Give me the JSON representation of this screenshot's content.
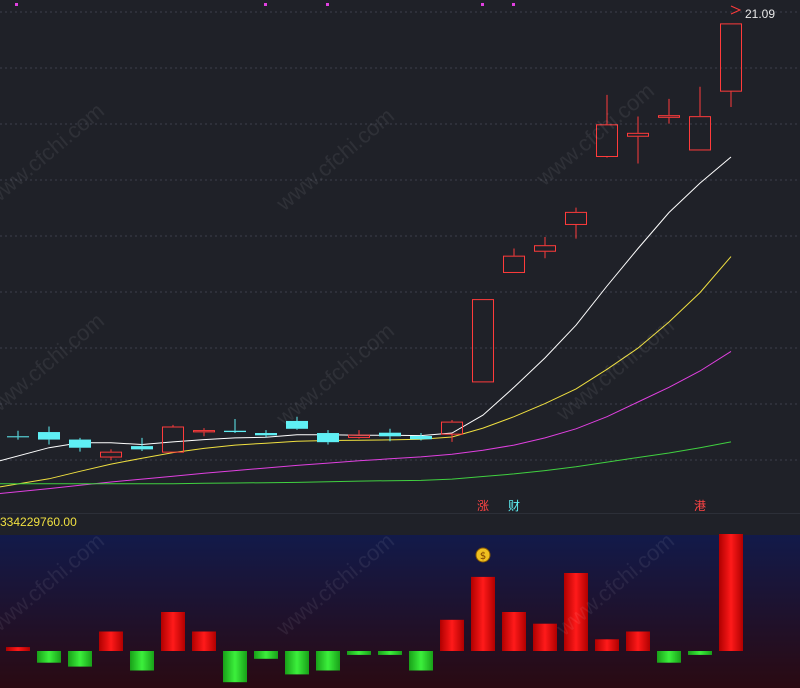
{
  "chart_data": [
    {
      "type": "candlestick",
      "title": "",
      "price_label": "21.09",
      "markers": [
        {
          "label": "涨",
          "candle_index": 15
        },
        {
          "label": "财",
          "candle_index": 16
        },
        {
          "label": "港",
          "candle_index": 22
        }
      ],
      "candles": [
        {
          "open": 8.45,
          "close": 8.42,
          "high": 8.62,
          "low": 8.35
        },
        {
          "open": 8.58,
          "close": 8.35,
          "high": 8.75,
          "low": 8.2
        },
        {
          "open": 8.35,
          "close": 8.1,
          "high": 8.4,
          "low": 7.98
        },
        {
          "open": 7.8,
          "close": 7.98,
          "high": 8.05,
          "low": 7.72
        },
        {
          "open": 8.15,
          "close": 8.05,
          "high": 8.4,
          "low": 8.0
        },
        {
          "open": 7.95,
          "close": 8.75,
          "high": 8.8,
          "low": 7.95
        },
        {
          "open": 8.57,
          "close": 8.64,
          "high": 8.7,
          "low": 8.45
        },
        {
          "open": 8.62,
          "close": 8.58,
          "high": 8.98,
          "low": 8.55
        },
        {
          "open": 8.55,
          "close": 8.48,
          "high": 8.64,
          "low": 8.42
        },
        {
          "open": 8.92,
          "close": 8.68,
          "high": 9.05,
          "low": 8.65
        },
        {
          "open": 8.55,
          "close": 8.27,
          "high": 8.64,
          "low": 8.2
        },
        {
          "open": 8.4,
          "close": 8.5,
          "high": 8.64,
          "low": 8.38
        },
        {
          "open": 8.56,
          "close": 8.45,
          "high": 8.68,
          "low": 8.3
        },
        {
          "open": 8.46,
          "close": 8.36,
          "high": 8.55,
          "low": 8.32
        },
        {
          "open": 8.5,
          "close": 8.9,
          "high": 8.95,
          "low": 8.28
        },
        {
          "open": 10.1,
          "close": 12.65,
          "high": 12.65,
          "low": 10.1
        },
        {
          "open": 13.45,
          "close": 13.98,
          "high": 14.2,
          "low": 13.45
        },
        {
          "open": 14.1,
          "close": 14.3,
          "high": 14.55,
          "low": 13.9
        },
        {
          "open": 14.92,
          "close": 15.32,
          "high": 15.45,
          "low": 14.5
        },
        {
          "open": 17.0,
          "close": 18.0,
          "high": 18.9,
          "low": 16.98
        },
        {
          "open": 17.62,
          "close": 17.74,
          "high": 18.24,
          "low": 16.8
        },
        {
          "open": 18.2,
          "close": 18.28,
          "high": 18.78,
          "low": 18.02
        },
        {
          "open": 17.2,
          "close": 18.25,
          "high": 19.15,
          "low": 17.2
        },
        {
          "open": 19.0,
          "close": 21.09,
          "high": 21.09,
          "low": 18.53
        }
      ],
      "moving_averages": [
        {
          "color": "#ffffff",
          "values": [
            7.7,
            8.1,
            8.25,
            8.25,
            8.2,
            8.28,
            8.35,
            8.4,
            8.42,
            8.5,
            8.5,
            8.48,
            8.48,
            8.47,
            8.55,
            9.1,
            9.95,
            10.85,
            11.85,
            13.05,
            14.2,
            15.3,
            16.2,
            17.0
          ]
        },
        {
          "color": "#f0e040",
          "values": [
            6.9,
            7.15,
            7.38,
            7.6,
            7.78,
            7.95,
            8.08,
            8.18,
            8.24,
            8.3,
            8.32,
            8.33,
            8.34,
            8.36,
            8.43,
            8.7,
            9.05,
            9.45,
            9.9,
            10.5,
            11.15,
            11.95,
            12.85,
            13.95
          ]
        },
        {
          "color": "#e040e0",
          "values": [
            6.7,
            6.85,
            6.95,
            7.05,
            7.14,
            7.23,
            7.32,
            7.4,
            7.48,
            7.56,
            7.63,
            7.7,
            7.76,
            7.82,
            7.9,
            8.02,
            8.18,
            8.4,
            8.68,
            9.05,
            9.5,
            9.95,
            10.45,
            11.05
          ]
        },
        {
          "color": "#40d040",
          "values": [
            7.0,
            7.0,
            7.0,
            7.0,
            7.0,
            7.0,
            7.01,
            7.02,
            7.03,
            7.04,
            7.06,
            7.08,
            7.09,
            7.1,
            7.14,
            7.22,
            7.3,
            7.4,
            7.52,
            7.66,
            7.8,
            7.94,
            8.1,
            8.28
          ]
        }
      ],
      "ylim": [
        6.5,
        21.5
      ]
    },
    {
      "type": "bar",
      "title": "",
      "value_label": "334229760.00",
      "values": [
        1,
        -3,
        -4,
        5,
        -5,
        10,
        5,
        -8,
        -2,
        -6,
        -5,
        -1,
        -1,
        -5,
        8,
        19,
        10,
        7,
        20,
        3,
        5,
        -3,
        -1,
        30
      ],
      "ylim": [
        -10,
        30
      ]
    }
  ]
}
